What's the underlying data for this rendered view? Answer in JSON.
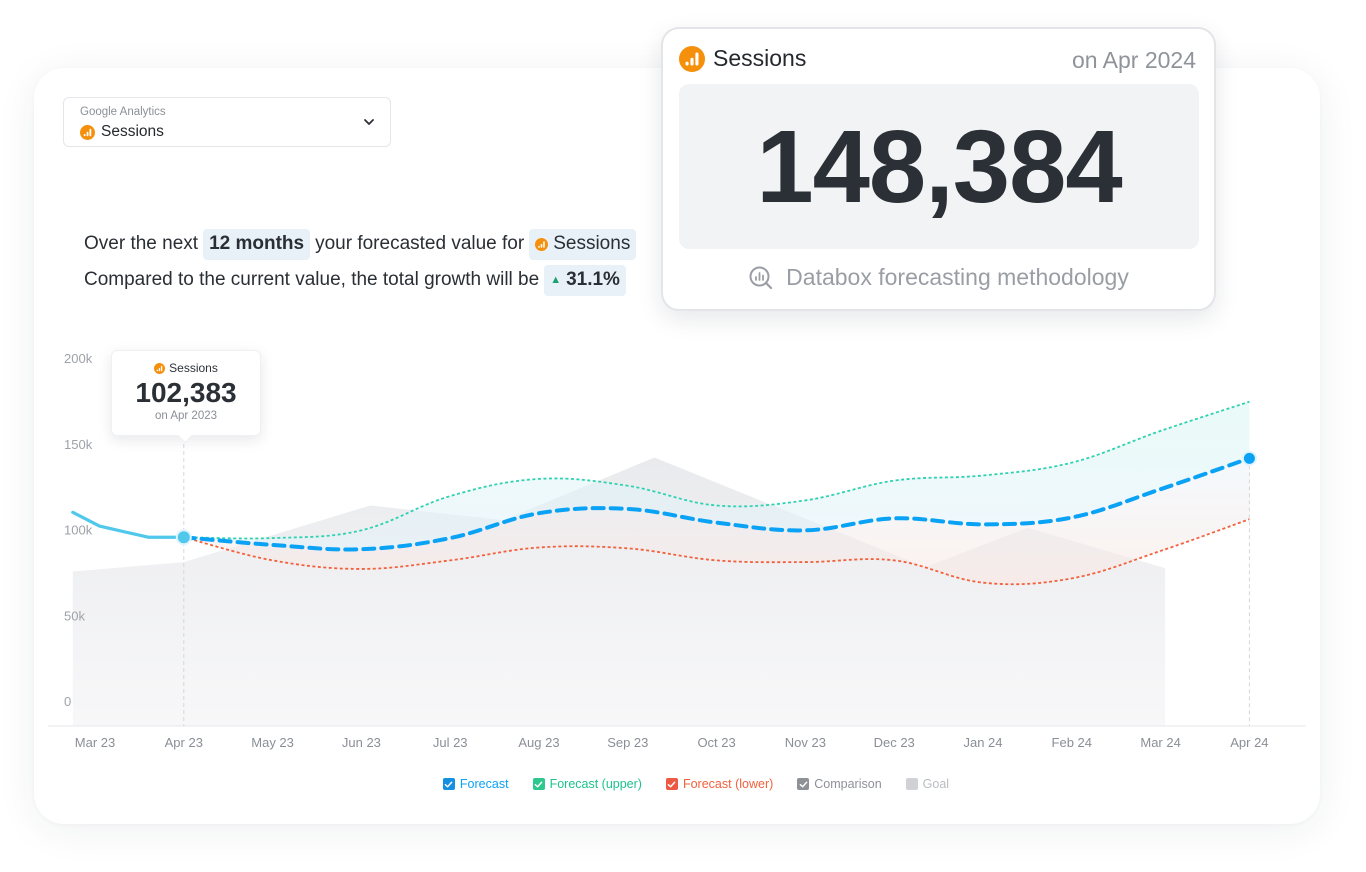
{
  "selector": {
    "source": "Google Analytics",
    "metric": "Sessions",
    "icon": "google-analytics-icon"
  },
  "summary": {
    "line1_prefix": "Over the next",
    "period": "12 months",
    "line1_middle": "your forecasted value for",
    "metric": "Sessions",
    "line2_prefix": "Compared to the current value, the total growth will be",
    "growth_direction": "up",
    "growth": "31.1%"
  },
  "forecast_card": {
    "metric": "Sessions",
    "date": "on Apr 2024",
    "value": "148,384",
    "methodology_link": "Databox forecasting methodology"
  },
  "tooltip": {
    "metric": "Sessions",
    "value": "102,383",
    "date": "on Apr 2023"
  },
  "colors": {
    "accent_orange": "#f5900d",
    "actual": "#4fc8ec",
    "forecast": "#0aa2f5",
    "forecast_upper": "#2fd2b0",
    "forecast_lower": "#f2613d",
    "comparison": "#8e9196",
    "goal": "#c7c9cc"
  },
  "chart_data": {
    "type": "line",
    "title": "",
    "xlabel": "",
    "ylabel": "",
    "ylim": [
      0,
      200000
    ],
    "yticks": [
      0,
      50000,
      100000,
      150000,
      200000
    ],
    "ytick_labels": [
      "0",
      "50k",
      "100k",
      "150k",
      "200k"
    ],
    "categories": [
      "Mar 23",
      "Apr 23",
      "May 23",
      "Jun 23",
      "Jul 23",
      "Aug 23",
      "Sep 23",
      "Oct 23",
      "Nov 23",
      "Dec 23",
      "Jan 24",
      "Feb 24",
      "Mar 24",
      "Apr 24"
    ],
    "grid": false,
    "legend_position": "bottom-center",
    "actual": {
      "name": "Sessions",
      "points": [
        [
          -0.25,
          110000
        ],
        [
          0.05,
          102000
        ],
        [
          0.6,
          95500
        ],
        [
          1,
          95500
        ]
      ]
    },
    "series": [
      {
        "name": "Forecast",
        "key": "forecast",
        "values": [
          null,
          95500,
          91000,
          88500,
          95000,
          109500,
          112000,
          104000,
          99500,
          106500,
          103000,
          107000,
          123500,
          141500
        ]
      },
      {
        "name": "Forecast (upper)",
        "key": "forecast_upper",
        "values": [
          null,
          95500,
          95000,
          99500,
          119500,
          129500,
          125500,
          114000,
          117000,
          128500,
          131500,
          139000,
          157500,
          174500
        ]
      },
      {
        "name": "Forecast (lower)",
        "key": "forecast_lower",
        "values": [
          null,
          95500,
          82000,
          77000,
          82000,
          89500,
          89000,
          82000,
          81000,
          82000,
          69000,
          71500,
          87500,
          106000
        ]
      }
    ],
    "comparison": {
      "name": "Comparison",
      "points": [
        [
          -0.25,
          75500
        ],
        [
          1,
          81000
        ],
        [
          3.1,
          114000
        ],
        [
          4.6,
          105500
        ],
        [
          6.3,
          142000
        ],
        [
          9.35,
          78000
        ],
        [
          10.5,
          101000
        ],
        [
          12.05,
          77500
        ]
      ]
    },
    "highlight": {
      "index": 1,
      "label": "102,383"
    },
    "end_marker": {
      "index": 13,
      "label": "148,384"
    },
    "legend": [
      {
        "label": "Forecast",
        "key": "forecast",
        "checked": true
      },
      {
        "label": "Forecast (upper)",
        "key": "forecast_upper",
        "checked": true
      },
      {
        "label": "Forecast (lower)",
        "key": "forecast_lower",
        "checked": true
      },
      {
        "label": "Comparison",
        "key": "comparison",
        "checked": true
      },
      {
        "label": "Goal",
        "key": "goal",
        "checked": false
      }
    ]
  }
}
